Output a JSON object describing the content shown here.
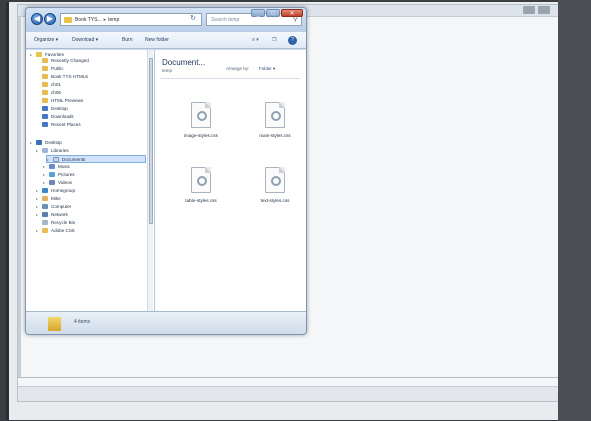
{
  "explorer": {
    "address": {
      "parts": [
        "Book TYS...",
        "temp"
      ]
    },
    "search_placeholder": "Search temp",
    "toolbar": {
      "organize": "Organize ▾",
      "download": "Download ▾",
      "burn": "Burn",
      "new_folder": "New folder"
    },
    "nav": {
      "items": [
        {
          "label": "Favorites",
          "icon": "star-icon"
        },
        {
          "label": "Recently Changed",
          "icon": "folder-icon"
        },
        {
          "label": "Public",
          "icon": "folder-icon"
        },
        {
          "label": "Book TYS HTML5",
          "icon": "folder-icon"
        },
        {
          "label": "ch01",
          "icon": "folder-icon"
        },
        {
          "label": "ch06",
          "icon": "folder-icon"
        },
        {
          "label": "HTML Previews",
          "icon": "folder-icon"
        },
        {
          "label": "Desktop",
          "icon": "desktop-icon"
        },
        {
          "label": "Downloads",
          "icon": "download-folder-icon"
        },
        {
          "label": "Recent Places",
          "icon": "recent-places-icon"
        },
        {
          "label": "Desktop",
          "icon": "desktop-icon"
        },
        {
          "label": "Libraries",
          "icon": "library-icon"
        },
        {
          "label": "Documents",
          "icon": "documents-icon"
        },
        {
          "label": "Music",
          "icon": "music-icon"
        },
        {
          "label": "Pictures",
          "icon": "pictures-icon"
        },
        {
          "label": "Videos",
          "icon": "videos-icon"
        },
        {
          "label": "Homegroup",
          "icon": "homegroup-icon"
        },
        {
          "label": "Mike",
          "icon": "user-folder-icon"
        },
        {
          "label": "Computer",
          "icon": "computer-icon"
        },
        {
          "label": "Network",
          "icon": "network-icon"
        },
        {
          "label": "Recycle Bin",
          "icon": "recycle-bin-icon"
        },
        {
          "label": "Adobe CS5",
          "icon": "folder-icon"
        }
      ],
      "selected_label": "Documents"
    },
    "content": {
      "library_title": "Document...",
      "library_subtitle": "temp",
      "arrange_label": "Arrange by:",
      "arrange_value": "Folder ▾",
      "files": [
        {
          "name": "image-styles.css",
          "icon": "css-file-icon"
        },
        {
          "name": "main-styles.css",
          "icon": "css-file-icon"
        },
        {
          "name": "table-styles.css",
          "icon": "css-file-icon"
        },
        {
          "name": "text-styles.css",
          "icon": "css-file-icon"
        }
      ]
    },
    "status": {
      "item_count": "4 items"
    }
  }
}
